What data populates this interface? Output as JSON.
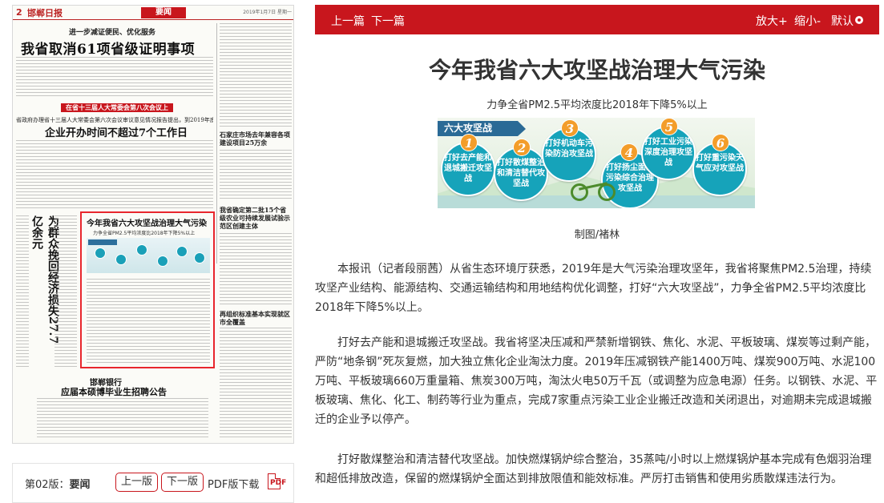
{
  "newspaper": {
    "page_number": "2",
    "brand": "邯郸日报",
    "section": "要闻",
    "header_date": "2019年1月7日 星期一",
    "lead_kicker": "进一步减证便民、优化服务",
    "lead_headline": "我省取消61项省级证明事项",
    "band_text": "在省十三届人大常委会第八次会议上",
    "second_kicker": "省政府办理省十三届人大常委会第六次会议审议意见情况报告提出，到2019年底",
    "second_headline": "企业开办时间不超过7个工作日",
    "vertical_headline": "为群众挽回经济损失27.7亿余元",
    "right_small_1": "石家庄市场去年兼容各项建设项目25万余",
    "right_small_2": "我省确定第二批15个省级农业可持续发展试验示范区创建主体",
    "right_small_3": "再组织标准基本实现就区市全覆盖",
    "boxed_article": {
      "title": "今年我省六大攻坚战治理大气污染",
      "subtitle": "力争全省PM2.5平均浓度比2018年下降5%以上",
      "graphic_label": "六大攻坚战"
    },
    "bottom_kicker": "邯郸银行",
    "bottom_headline": "应届本硕博毕业生招聘公告"
  },
  "page_footer": {
    "issue_label": "第02版：",
    "issue_section": "要闻",
    "prev_page": "上一版",
    "next_page": "下一版",
    "pdf_label": "PDF版下载",
    "pdf_icon_text": "PDF"
  },
  "toolbar": {
    "prev_article": "上一篇",
    "next_article": "下一篇",
    "zoom_in": "放大+",
    "zoom_out": "缩小-",
    "default_size": "默认"
  },
  "article": {
    "title": "今年我省六大攻坚战治理大气污染",
    "subtitle": "力争全省PM2.5平均浓度比2018年下降5%以上",
    "graphic": {
      "label": "六大攻坚战",
      "steps": [
        {
          "n": "1",
          "text": "打好去产能和退城搬迁攻坚战"
        },
        {
          "n": "2",
          "text": "打好散煤整治和清洁替代攻坚战"
        },
        {
          "n": "3",
          "text": "打好机动车污染防治攻坚战"
        },
        {
          "n": "4",
          "text": "打好扬尘面源污染综合治理攻坚战"
        },
        {
          "n": "5",
          "text": "打好工业污染深度治理攻坚战"
        },
        {
          "n": "6",
          "text": "打好重污染天气应对攻坚战"
        }
      ]
    },
    "caption": "制图/褚林",
    "paragraphs": [
      "本报讯（记者段丽茜）从省生态环境厅获悉，2019年是大气污染治理攻坚年，我省将聚焦PM2.5治理，持续攻坚产业结构、能源结构、交通运输结构和用地结构优化调整，打好“六大攻坚战”，力争全省PM2.5平均浓度比2018年下降5%以上。",
      "打好去产能和退城搬迁攻坚战。我省将坚决压减和严禁新增钢铁、焦化、水泥、平板玻璃、煤炭等过剩产能，严防“地条钢”死灰复燃，加大独立焦化企业淘汰力度。2019年压减钢铁产能1400万吨、煤炭900万吨、水泥100万吨、平板玻璃660万重量箱、焦炭300万吨，淘汰火电50万千瓦（或调整为应急电源）任务。以钢铁、水泥、平板玻璃、焦化、化工、制药等行业为重点，完成7家重点污染工业企业搬迁改造和关闭退出，对逾期未完成退城搬迁的企业予以停产。",
      "打好散煤整治和清洁替代攻坚战。加快燃煤锅炉综合整治，35蒸吨/小时以上燃煤锅炉基本完成有色烟羽治理和超低排放改造，保留的燃煤锅炉全面达到排放限值和能效标准。严厉打击销售和使用劣质散煤违法行为。"
    ]
  }
}
